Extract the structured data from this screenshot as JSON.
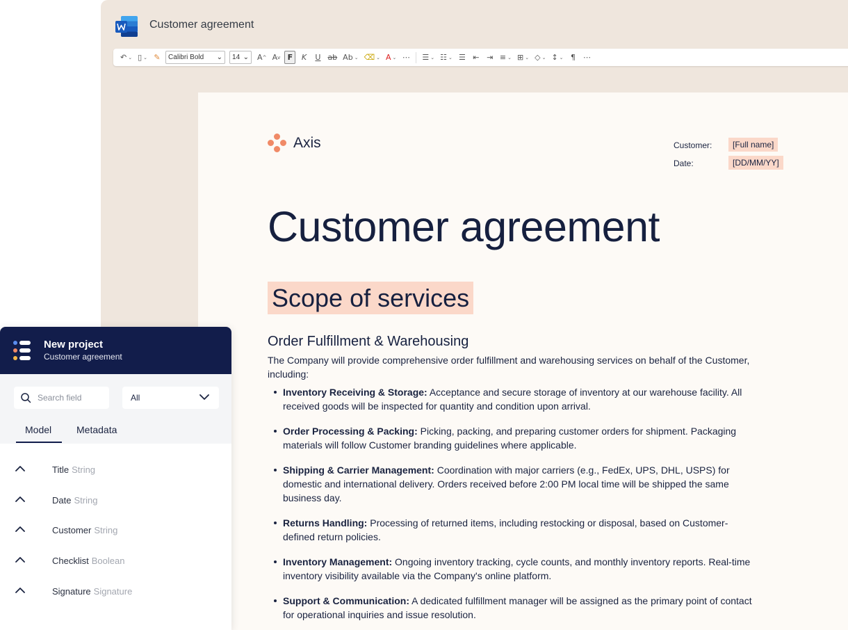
{
  "window": {
    "title": "Customer agreement",
    "app_icon": "word-icon",
    "accent": "#185abd"
  },
  "toolbar": {
    "font_name": "Calibri Bold",
    "font_size": "14",
    "bold_label": "F",
    "icons": [
      "undo-icon",
      "paste-icon",
      "format-painter-icon",
      "grow-font-icon",
      "shrink-font-icon",
      "bold-icon",
      "italic-icon",
      "underline-icon",
      "strikethrough-icon",
      "text-effects-icon",
      "highlight-icon",
      "font-color-icon",
      "more-icon",
      "bullets-icon",
      "numbering-icon",
      "multilevel-list-icon",
      "decrease-indent-icon",
      "increase-indent-icon",
      "align-icon",
      "borders-icon",
      "shading-icon",
      "line-spacing-icon",
      "paragraph-icon",
      "more-icon"
    ]
  },
  "document": {
    "logo_text": "Axis",
    "customer_label": "Customer:",
    "customer_value": "[Full name]",
    "date_label": "Date:",
    "date_value": "[DD/MM/YY]",
    "title": "Customer agreement",
    "section": "Scope of services",
    "subsection": "Order Fulfillment & Warehousing",
    "intro": "The Company will provide comprehensive order fulfillment and warehousing services on behalf of the Customer, including:",
    "bullets": [
      {
        "bold": "Inventory Receiving & Storage:",
        "text": " Acceptance and secure storage of inventory at our warehouse facility. All received goods will be inspected for quantity and condition upon arrival."
      },
      {
        "bold": "Order Processing & Packing:",
        "text": " Picking, packing, and preparing customer orders for shipment. Packaging materials will follow Customer branding guidelines where applicable."
      },
      {
        "bold": "Shipping & Carrier Management:",
        "text": " Coordination with major carriers (e.g., FedEx, UPS, DHL, USPS) for domestic and international delivery. Orders received before 2:00 PM local time will be shipped the same business day."
      },
      {
        "bold": "Returns Handling:",
        "text": " Processing of returned items, including restocking or disposal, based on Customer-defined return policies."
      },
      {
        "bold": "Inventory Management:",
        "text": " Ongoing inventory tracking, cycle counts, and monthly inventory reports. Real-time inventory visibility available via the Company's online platform."
      },
      {
        "bold": "Support & Communication:",
        "text": " A dedicated fulfillment manager will be assigned as the primary point of contact for operational inquiries and issue resolution."
      }
    ],
    "highlight_color": "#fbd8c9",
    "logo_color": "#f08a67"
  },
  "panel": {
    "title": "New project",
    "subtitle": "Customer agreement",
    "search_placeholder": "Search field",
    "filter_value": "All",
    "tabs": [
      "Model",
      "Metadata"
    ],
    "active_tab": "Model",
    "fields": [
      {
        "name": "Title",
        "type": "String"
      },
      {
        "name": "Date",
        "type": "String"
      },
      {
        "name": "Customer",
        "type": "String"
      },
      {
        "name": "Checklist",
        "type": "Boolean"
      },
      {
        "name": "Signature",
        "type": "Signature"
      }
    ],
    "header_color": "#121d4b"
  }
}
